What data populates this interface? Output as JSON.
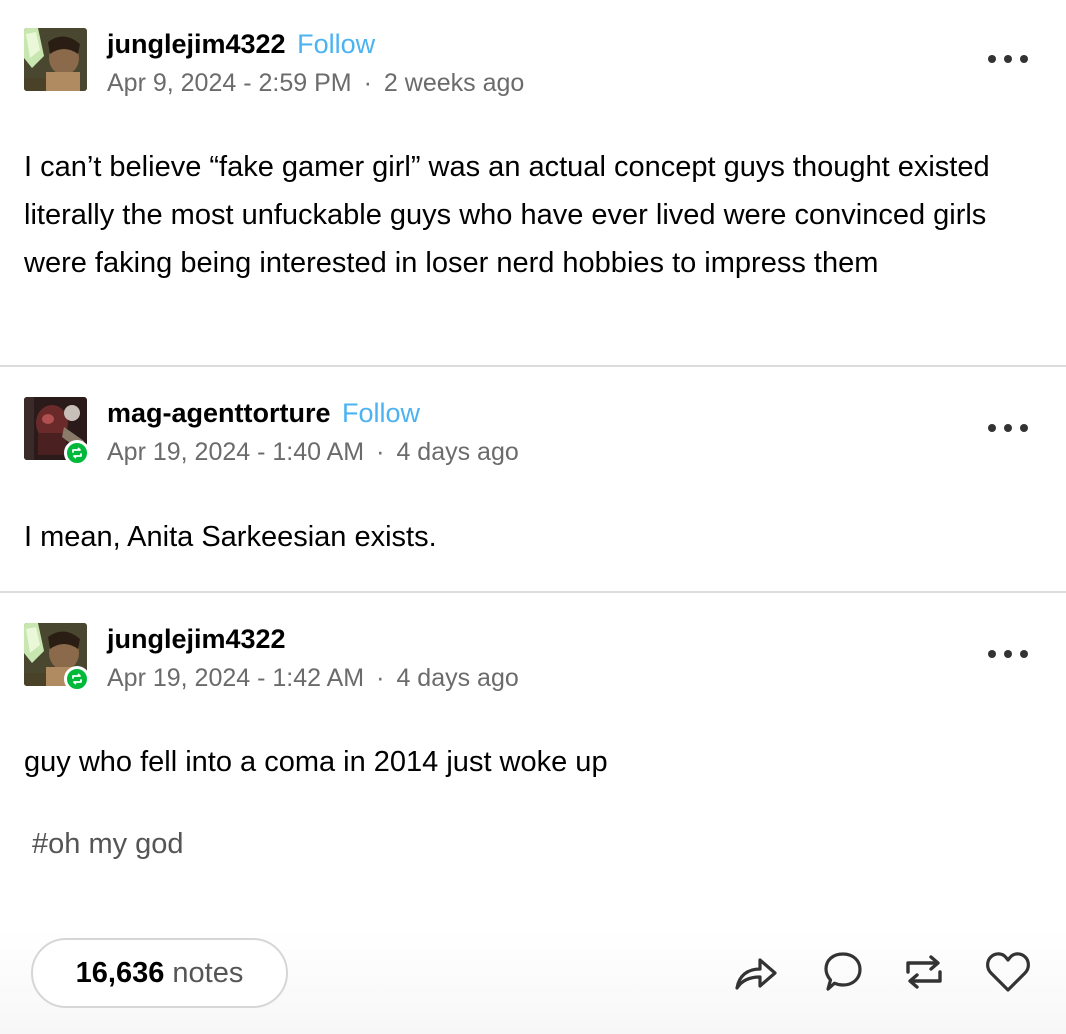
{
  "posts": [
    {
      "username": "junglejim4322",
      "follow_label": "Follow",
      "date": "Apr 9, 2024 - 2:59 PM",
      "relative": "2 weeks ago",
      "body": "I can’t believe “fake gamer girl” was an actual concept guys thought existed literally the most unfuckable guys who have ever lived were convinced girls were faking being interested in loser nerd hobbies to impress them"
    },
    {
      "username": "mag-agenttorture",
      "follow_label": "Follow",
      "date": "Apr 19, 2024 - 1:40 AM",
      "relative": "4 days ago",
      "body": "I mean, Anita Sarkeesian exists."
    },
    {
      "username": "junglejim4322",
      "date": "Apr 19, 2024 - 1:42 AM",
      "relative": "4 days ago",
      "body": "guy who fell into a coma in 2014 just woke up"
    }
  ],
  "separator": "·",
  "tag": "#oh my god",
  "footer": {
    "notes_count": "16,636",
    "notes_label": "notes",
    "actions": [
      "share-icon",
      "reply-icon",
      "reblog-icon",
      "like-icon"
    ]
  },
  "colors": {
    "follow": "#4bb3f1",
    "reblog_badge": "#00b93a",
    "meta_text": "#6b6b6b",
    "divider": "#dcdcdc"
  }
}
